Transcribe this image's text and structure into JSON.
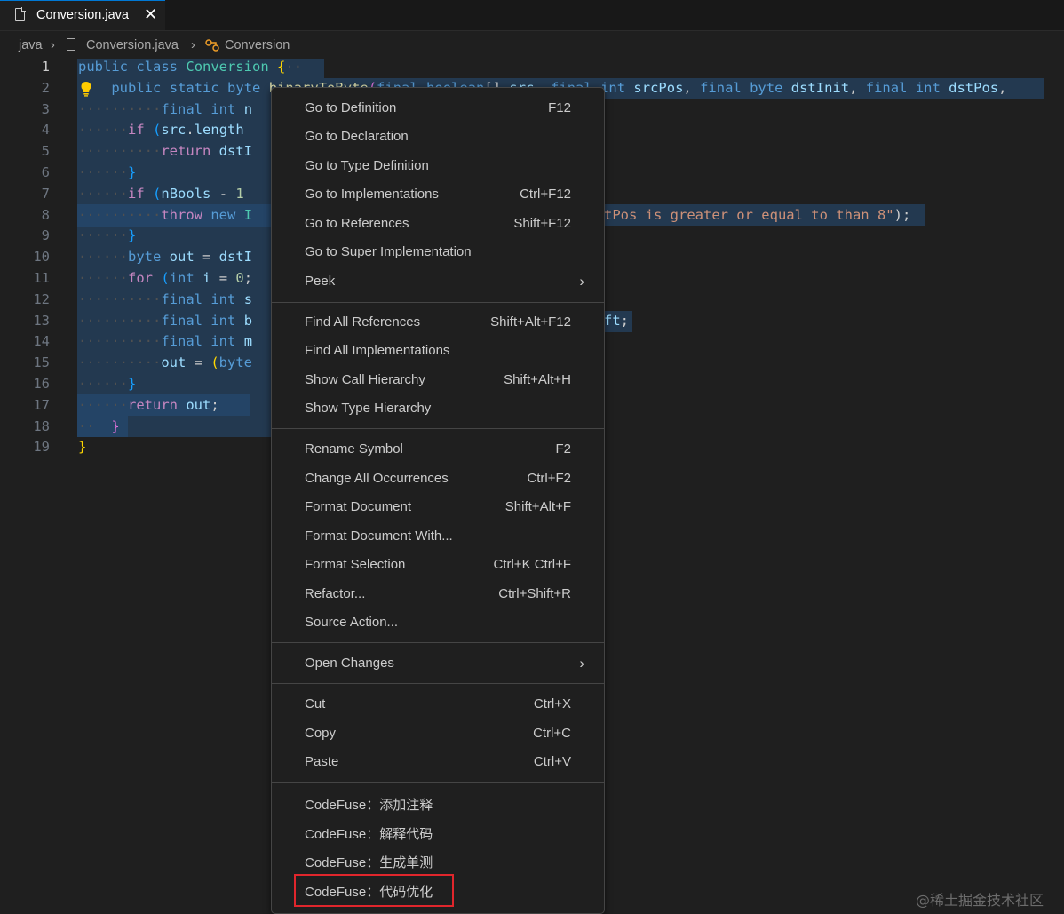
{
  "tab": {
    "filename": "Conversion.java",
    "close_glyph": "✕"
  },
  "breadcrumb": {
    "items": [
      "java",
      "Conversion.java",
      "Conversion"
    ],
    "separator": "›"
  },
  "editor": {
    "line_numbers": [
      "1",
      "2",
      "3",
      "4",
      "5",
      "6",
      "7",
      "8",
      "9",
      "10",
      "11",
      "12",
      "13",
      "14",
      "15",
      "16",
      "17",
      "18",
      "19"
    ],
    "active_line": "1"
  },
  "menu": {
    "groups": [
      [
        {
          "label": "Go to Definition",
          "key": "F12"
        },
        {
          "label": "Go to Declaration",
          "key": ""
        },
        {
          "label": "Go to Type Definition",
          "key": ""
        },
        {
          "label": "Go to Implementations",
          "key": "Ctrl+F12"
        },
        {
          "label": "Go to References",
          "key": "Shift+F12"
        },
        {
          "label": "Go to Super Implementation",
          "key": ""
        },
        {
          "label": "Peek",
          "key": "",
          "submenu": true
        }
      ],
      [
        {
          "label": "Find All References",
          "key": "Shift+Alt+F12"
        },
        {
          "label": "Find All Implementations",
          "key": ""
        },
        {
          "label": "Show Call Hierarchy",
          "key": "Shift+Alt+H"
        },
        {
          "label": "Show Type Hierarchy",
          "key": ""
        }
      ],
      [
        {
          "label": "Rename Symbol",
          "key": "F2"
        },
        {
          "label": "Change All Occurrences",
          "key": "Ctrl+F2"
        },
        {
          "label": "Format Document",
          "key": "Shift+Alt+F"
        },
        {
          "label": "Format Document With...",
          "key": ""
        },
        {
          "label": "Format Selection",
          "key": "Ctrl+K Ctrl+F"
        },
        {
          "label": "Refactor...",
          "key": "Ctrl+Shift+R"
        },
        {
          "label": "Source Action...",
          "key": ""
        }
      ],
      [
        {
          "label": "Open Changes",
          "key": "",
          "submenu": true
        }
      ],
      [
        {
          "label": "Cut",
          "key": "Ctrl+X"
        },
        {
          "label": "Copy",
          "key": "Ctrl+C"
        },
        {
          "label": "Paste",
          "key": "Ctrl+V"
        }
      ],
      [
        {
          "label": "CodeFuse：添加注释",
          "key": ""
        },
        {
          "label": "CodeFuse：解释代码",
          "key": ""
        },
        {
          "label": "CodeFuse：生成单测",
          "key": ""
        },
        {
          "label": "CodeFuse：代码优化",
          "key": "",
          "highlighted": true
        }
      ]
    ],
    "submenu_glyph": "›"
  },
  "watermark": "@稀土掘金技术社区",
  "colors": {
    "highlight_box": "#e0262c",
    "selection": "#264f78",
    "active_tab_border": "#0078d4"
  }
}
